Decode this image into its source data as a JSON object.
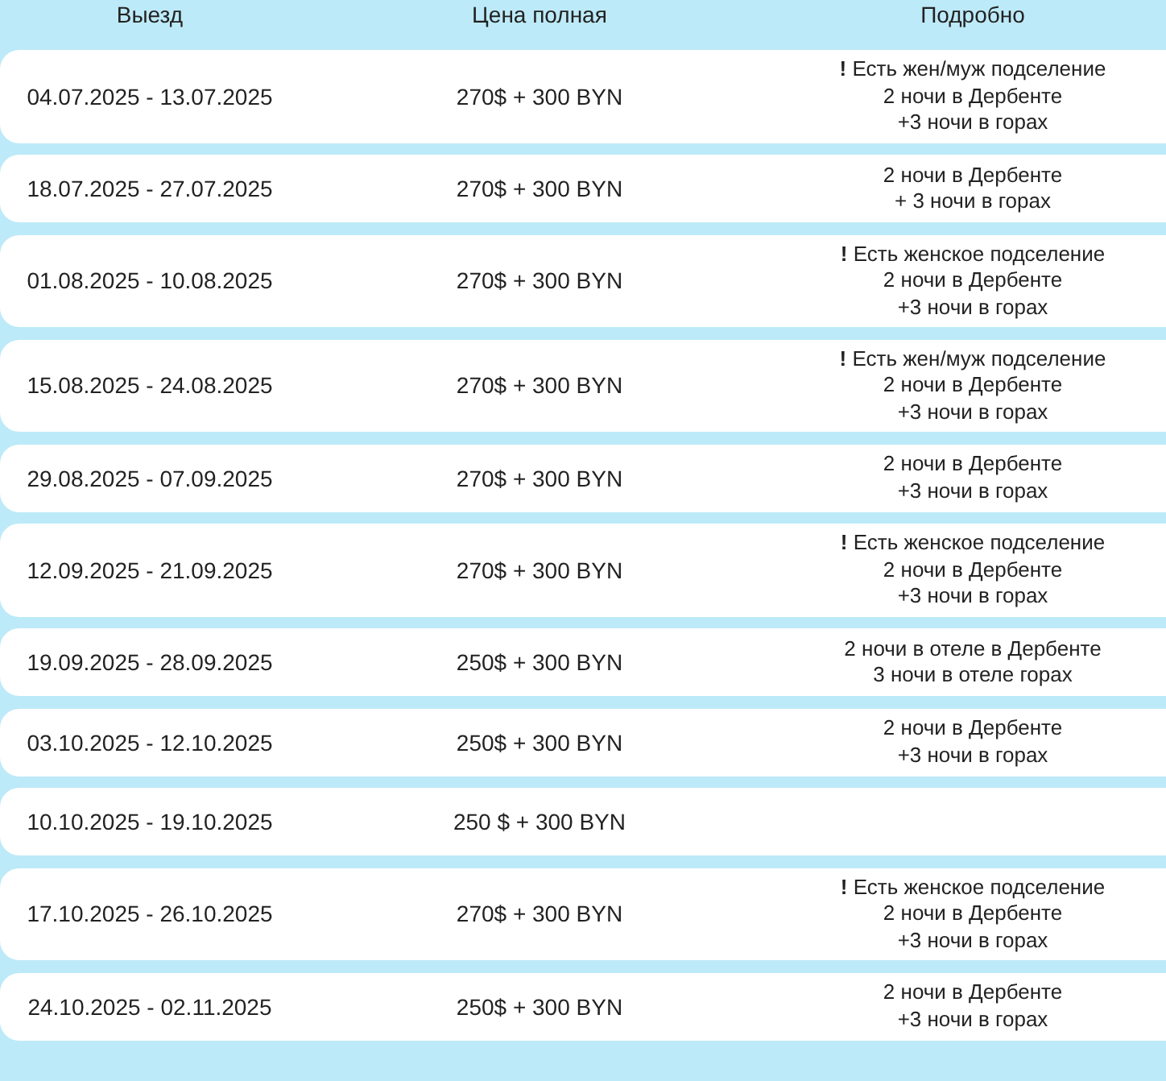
{
  "table": {
    "columns": [
      "Выезд",
      "Цена полная",
      "Подробно"
    ],
    "rows": [
      {
        "dates": "04.07.2025 - 13.07.2025",
        "price": "270$ + 300 BYN",
        "details": [
          "**!** Есть жен/муж подселение",
          "2 ночи в Дербенте",
          "+3 ночи в горах"
        ]
      },
      {
        "dates": "18.07.2025 - 27.07.2025",
        "price": "270$ + 300 BYN",
        "details": [
          "2 ночи в Дербенте",
          "+ 3 ночи в горах"
        ]
      },
      {
        "dates": "01.08.2025 - 10.08.2025",
        "price": "270$ + 300 BYN",
        "details": [
          "**!** Есть женское подселение",
          "2 ночи в Дербенте",
          "+3 ночи в горах"
        ]
      },
      {
        "dates": "15.08.2025 - 24.08.2025",
        "price": "270$ + 300 BYN",
        "details": [
          "**!** Есть жен/муж подселение",
          "2 ночи в Дербенте",
          "+3 ночи в горах"
        ]
      },
      {
        "dates": "29.08.2025 - 07.09.2025",
        "price": "270$ + 300 BYN",
        "details": [
          "2 ночи в Дербенте",
          "+3 ночи в горах"
        ]
      },
      {
        "dates": "12.09.2025 - 21.09.2025",
        "price": "270$ + 300 BYN",
        "details": [
          "**!** Есть женское подселение",
          "2 ночи в Дербенте",
          "+3 ночи в горах"
        ]
      },
      {
        "dates": "19.09.2025 - 28.09.2025",
        "price": "250$ + 300 BYN",
        "details": [
          "2 ночи в отеле в Дербенте",
          "3 ночи в отеле горах"
        ]
      },
      {
        "dates": "03.10.2025 - 12.10.2025",
        "price": "250$ + 300 BYN",
        "details": [
          "2 ночи в Дербенте",
          "+3 ночи в горах"
        ]
      },
      {
        "dates": "10.10.2025 - 19.10.2025",
        "price": "250 $ + 300 BYN"
      },
      {
        "dates": "17.10.2025 - 26.10.2025",
        "price": "270$ + 300 BYN",
        "details": [
          "**!** Есть женское подселение",
          "2 ночи в Дербенте",
          "+3 ночи в горах"
        ]
      },
      {
        "dates": "24.10.2025 - 02.11.2025",
        "price": "250$ + 300 BYN",
        "details": [
          "2 ночи в Дербенте",
          "+3 ночи в горах"
        ]
      }
    ]
  }
}
